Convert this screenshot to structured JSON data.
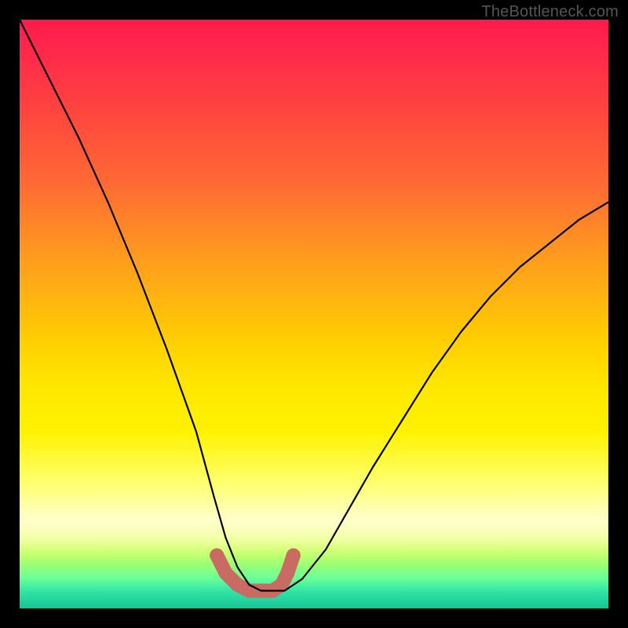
{
  "watermark": "TheBottleneck.com",
  "chart_data": {
    "type": "line",
    "title": "",
    "xlabel": "",
    "ylabel": "",
    "xlim": [
      0,
      100
    ],
    "ylim": [
      0,
      100
    ],
    "grid": false,
    "series": [
      {
        "name": "curve",
        "color": "#000000",
        "x": [
          0,
          5,
          10,
          15,
          20,
          25,
          30,
          33,
          35,
          37,
          39,
          41,
          43,
          45,
          48,
          52,
          56,
          60,
          65,
          70,
          75,
          80,
          85,
          90,
          95,
          100
        ],
        "y": [
          100,
          90,
          80,
          69,
          57,
          44,
          30,
          19,
          12,
          7,
          4,
          3,
          3,
          3,
          5,
          10,
          17,
          24,
          32,
          40,
          47,
          53,
          58,
          62,
          66,
          69
        ]
      }
    ],
    "highlight": {
      "name": "bottom-markers",
      "color": "#c96a63",
      "x": [
        33.5,
        35,
        37,
        39,
        41,
        43,
        44.5,
        45.5,
        46.5
      ],
      "y": [
        9,
        6,
        4,
        3,
        3,
        3,
        4,
        6,
        9
      ],
      "marker_radius_px": 9
    }
  }
}
